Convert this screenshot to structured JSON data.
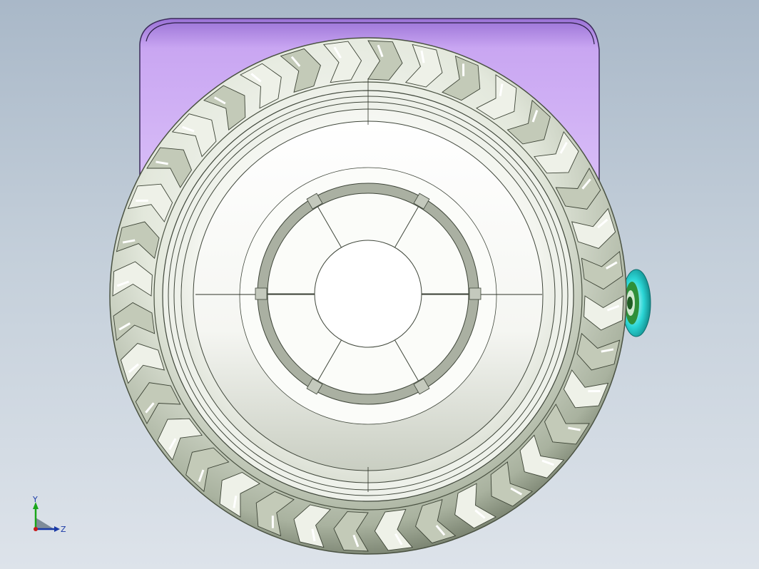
{
  "viewport": {
    "background_top": "#a9b8c8",
    "background_bottom": "#dde3ea"
  },
  "model": {
    "body_color": "#c9a6f2",
    "body_outline": "#3b2a5a",
    "tire_color": "#d9dfcf",
    "tire_shadow": "#6f7a66",
    "rim_color": "#f4f6f1",
    "hub_ring_color": "#b7bdb0",
    "side_knob_color": "#2bd6d6",
    "side_knob_inner_color": "#1f7d2c"
  },
  "triad": {
    "y_label": "Y",
    "z_label": "Z",
    "y_color": "#1aa61a",
    "z_color": "#1a3aa6",
    "x_color": "#c81a1a",
    "plane_color": "#7f8c99"
  }
}
